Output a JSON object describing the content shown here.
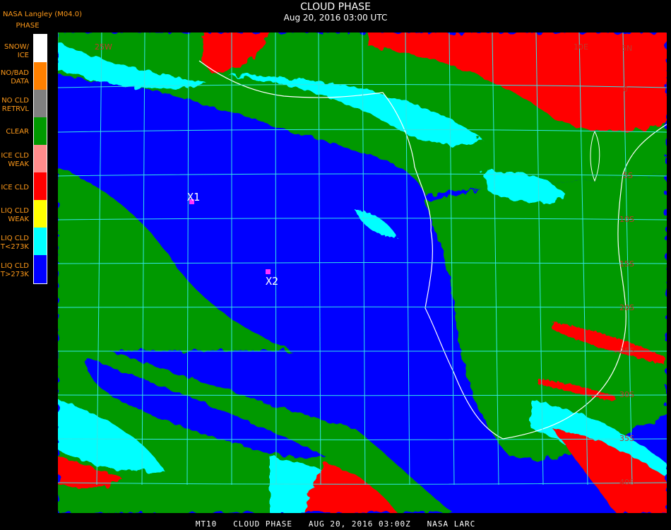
{
  "header": {
    "org": "NASA Langley (M04.0)",
    "title": "CLOUD PHASE",
    "subtitle": "Aug 20, 2016 03:00 UTC"
  },
  "legend": {
    "title": "PHASE",
    "items": [
      {
        "label": "SNOW/\nICE",
        "color": "#ffffff"
      },
      {
        "label": "NO/BAD\nDATA",
        "color": "#ff8000"
      },
      {
        "label": "NO CLD\nRETRVL",
        "color": "#808080"
      },
      {
        "label": "CLEAR",
        "color": "#009900"
      },
      {
        "label": "ICE CLD\nWEAK",
        "color": "#ff8c8c"
      },
      {
        "label": "ICE CLD",
        "color": "#ff0000"
      },
      {
        "label": "LIQ CLD\nWEAK",
        "color": "#ffff00"
      },
      {
        "label": "LIQ CLD\nT<273K",
        "color": "#00ffff"
      },
      {
        "label": "LIQ CLD\nT>273K",
        "color": "#0000ff"
      }
    ]
  },
  "map": {
    "markers": [
      {
        "label": "X1"
      },
      {
        "label": "X2"
      }
    ],
    "lat_labels": [
      "5N",
      "0",
      "5S",
      "10S",
      "15S",
      "20S",
      "25S",
      "30S",
      "35S",
      "40S"
    ],
    "lon_labels": [
      "25W",
      "10E"
    ]
  },
  "footer": "MT10   CLOUD PHASE   AUG 20, 2016 03:00Z   NASA LARC"
}
